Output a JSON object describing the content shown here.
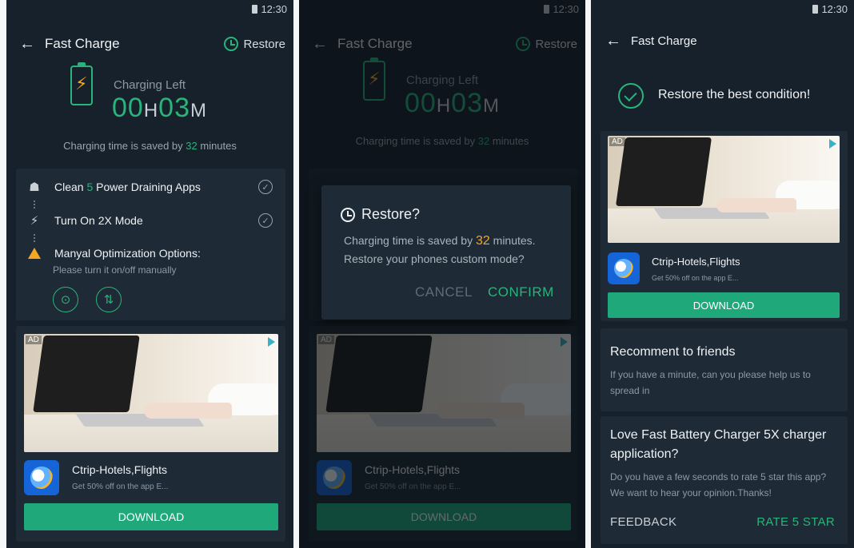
{
  "status": {
    "time": "12:30"
  },
  "header": {
    "back": "←",
    "title": "Fast Charge",
    "restore_label": "Restore"
  },
  "charge": {
    "label": "Charging Left",
    "hours": "00",
    "hours_unit": "H",
    "minutes": "03",
    "minutes_unit": "M",
    "saved_prefix": "Charging time is saved by ",
    "saved_minutes": "32",
    "saved_suffix": " minutes"
  },
  "options": {
    "clean_prefix": "Clean ",
    "clean_count": "5",
    "clean_suffix": " Power Draining Apps",
    "mode": "Turn On 2X Mode",
    "manual_title": "Manyal Optimization Options:",
    "manual_sub": "Please turn it on/off manually"
  },
  "ad": {
    "tag": "AD",
    "app_name": "Ctrip-Hotels,Flights",
    "app_desc": "Get 50% off on the app E...",
    "download": "DOWNLOAD"
  },
  "dialog": {
    "title": "Restore?",
    "line1_prefix": "Charging time is saved by ",
    "line1_minutes": "32",
    "line1_suffix": " minutes.",
    "line2": "Restore your phones custom mode?",
    "cancel": "CANCEL",
    "confirm": "CONFIRM"
  },
  "result": {
    "message": "Restore the best condition!",
    "recommend_title": "Recomment to friends",
    "recommend_body": "If you have a minute, can you please help us to spread in",
    "love_title": "Love Fast Battery Charger 5X charger application?",
    "love_body": "Do you have a few seconds to rate 5 star this app? We want to hear your opinion.Thanks!",
    "feedback": "FEEDBACK",
    "rate": "RATE 5 STAR"
  },
  "colors": {
    "accent": "#2ab37a",
    "highlight": "#f5a623",
    "background": "#17212b",
    "card": "#1e2a36"
  }
}
